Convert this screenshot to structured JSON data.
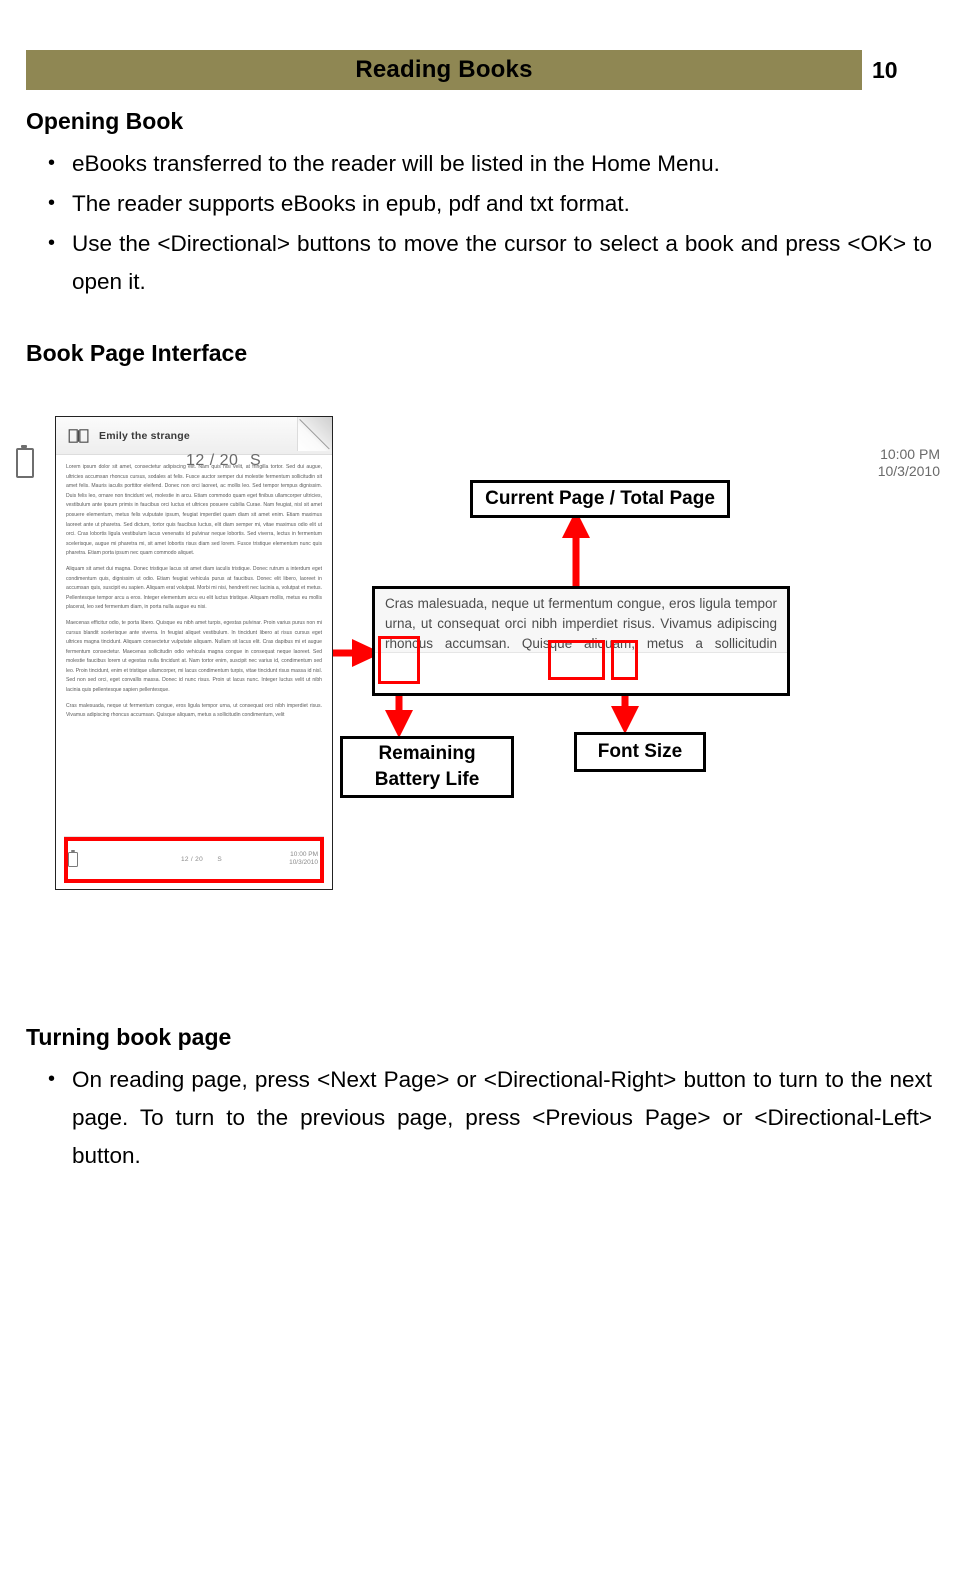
{
  "header": {
    "title": "Reading Books",
    "page_number": "10",
    "band_color": "#8F8753"
  },
  "sections": {
    "opening_book": {
      "heading": "Opening Book",
      "bullets": [
        "eBooks transferred to the reader will be listed in the Home Menu.",
        "The reader supports eBooks in epub, pdf and txt format.",
        "Use the <Directional> buttons to move the cursor to select a book and press <OK> to open it."
      ]
    },
    "book_page_interface": {
      "heading": "Book Page Interface"
    },
    "turning_book_page": {
      "heading": "Turning book page",
      "bullets": [
        "On reading page, press <Next Page> or <Directional-Right> button to turn to the next page. To turn to the previous page, press <Previous Page> or <Directional-Left> button."
      ]
    }
  },
  "figure": {
    "device": {
      "title": "Emily the strange",
      "body_paragraphs": [
        "Lorem ipsum dolor sit amet, consectetur adipiscing elit. Nam quis nisi velit, at fringilla tortor. Sed dui augue, ultricies accumsan rhoncus cursus, sodales at felis. Fusce auctor semper dui molestie fermentum sollicitudin sit amet felis. Mauris iaculis porttitor eleifend. Donec non orci laoreet, ac mollis leo. Sed tempor tempus dignissim. Duis felis leo, ornare non tincidunt vel, molestie in arcu. Etiam commodo quam eget finibus ullamcorper ultricies, vestibulum ante ipsum primis in faucibus orci luctus et ultrices posuere cubilia Curae. Nam feugiat, nisl sit amet posuere elementum, metus felis vulputate ipsum, feugiat imperdiet quam diam sit amet enim. Etiam maximus laoreet ante ut pharetra. Sed dictum, tortor quis faucibus luctus, elit diam semper mi, vitae maximus odio elit ut orci. Cras lobortis ligula vestibulum lacus venenatis id pulvinar neque lobortis. Sed viverra, lectus in fermentum scelerisque, augue mi pharetra mi, sit amet lobortis risus diam sed lorem. Fusce tristique elementum nunc quis pharetra. Etiam porta ipsum nec quam commodo aliquet.",
        "Aliquam sit amet dui magna. Donec tristique lacus sit amet diam iaculis tristique. Donec rutrum a interdum eget condimentum quis, dignissim ut odio. Etiam feugiat vehicula purus at faucibus. Donec elit libero, laoreet in accumsan quis, suscipit eu sapien. Aliquam erat volutpat. Morbi mi nisi, hendrerit nec lacinia a, volutpat et metus. Pellentesque tempor arcu a eros. Integer elementum arcu eu elit luctus tristique. Aliquam mollis, metus eu mollis placerat, leo sed fermentum diam, in porta nulla augue eu nisi.",
        "Maecenas efficitur odio, te porta libero. Quisque eu nibh amet turpis, egestas pulvinar. Proin varius purus non mi cursus blandit scelerisque ante viverra. In feugiat aliquet vestibulum. In tincidunt libero at risus cursus eget ultrices magna tincidunt. Aliquam consectetur vulputate aliquam. Nullam sit lacus elit. Cras dapibus mi et augue fermentum consectetur. Maecenas sollicitudin odio vehicula magna congue in consequat neque laoreet. Sed molestie faucibus lorem ut egestas nulla tincidunt at. Nam tortor enim, suscipit nec varius id, condimentum sed leo. Proin tincidunt, enim et tristique ullamcorper, mi lacus condimentum turpis, vitae tincidunt risus massa id nisl. Sed non sed orci, eget convallis massa. Donec id nunc risus. Proin ut lacus nunc. Integer luctus velit ut nibh lacinia quis pellentesque sapien pellentesque.",
        "Cras malesuada, neque ut fermentum congue, eros ligula tempor urna, ut consequat orci nibh imperdiet risus. Vivamus adipiscing rhoncus accumsan. Quisque aliquam, metus a sollicitudin condimentum, velit"
      ],
      "status": {
        "pages": "12 / 20",
        "font_size": "S",
        "time": "10:00 PM",
        "date": "10/3/2010"
      }
    },
    "magnified": {
      "text": "Cras malesuada, neque ut fermentum congue, eros ligula tempor urna, ut consequat orci nibh imperdiet risus. Vivamus adipiscing rhoncus accumsan. Quisque aliquam, metus a sollicitudin condimentum, velit",
      "pages": "12 / 20",
      "font_size": "S",
      "time": "10:00 PM",
      "date": "10/3/2010"
    },
    "callouts": {
      "current_page": "Current Page  / Total Page",
      "battery": "Remaining\nBattery Life",
      "battery_line1": "Remaining",
      "battery_line2": "Battery Life",
      "font_size": "Font Size"
    },
    "highlight_color": "#FF0000"
  }
}
